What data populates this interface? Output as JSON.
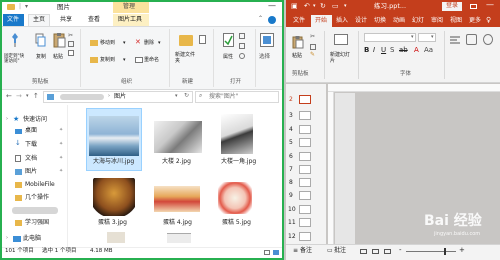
{
  "explorer": {
    "title": "图片",
    "ribbon_context_tab": "管理",
    "tabs": [
      "文件",
      "主页",
      "共享",
      "查看",
      "图片工具"
    ],
    "groups": [
      "剪贴板",
      "组织",
      "新建",
      "打开",
      "选择"
    ],
    "buttons": {
      "pin": "固定到\"快速访问\"",
      "copy": "复制",
      "paste": "粘贴",
      "move_to": "移动到",
      "copy_to": "复制到",
      "delete": "删除",
      "rename": "重命名",
      "new_folder": "新建文件夹",
      "properties": "属性"
    },
    "address_crumb": "图片",
    "search_placeholder": "搜索\"图片\"",
    "nav": [
      {
        "label": "快速访问"
      },
      {
        "label": "桌面"
      },
      {
        "label": "下载"
      },
      {
        "label": "文档"
      },
      {
        "label": "图片"
      },
      {
        "label": "MobileFile"
      },
      {
        "label": "几个操作"
      },
      {
        "label": "学习强国"
      },
      {
        "label": "此电脑"
      }
    ],
    "files": [
      {
        "name": "大海与冰川.jpg"
      },
      {
        "name": "大楼 2.jpg"
      },
      {
        "name": "大楼一角.jpg"
      },
      {
        "name": "蛋糕 3.jpg"
      },
      {
        "name": "蛋糕 4.jpg"
      },
      {
        "name": "蛋糕 5.jpg"
      }
    ],
    "status": {
      "count": "101 个项目",
      "selected": "选中 1 个项目",
      "size": "4.18 MB"
    }
  },
  "ppt": {
    "title": "练习.ppt...",
    "login": "登录",
    "tabs": [
      "文件",
      "开始",
      "插入",
      "设计",
      "切换",
      "动画",
      "幻灯",
      "审阅",
      "视图",
      "更多"
    ],
    "groups": [
      "剪贴板",
      "字体"
    ],
    "buttons": {
      "paste": "粘贴",
      "new_slide": "新建幻灯片"
    },
    "slide_numbers": [
      "2",
      "3",
      "4",
      "5",
      "6",
      "7",
      "8",
      "9",
      "10",
      "11",
      "12"
    ],
    "status": {
      "notes": "备注",
      "comments": "批注"
    },
    "watermark": "Bai 经验",
    "watermark_sub": "jingyan.baidu.com"
  }
}
